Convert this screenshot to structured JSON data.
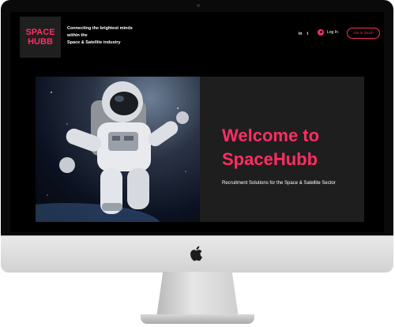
{
  "header": {
    "logo_line1": "SPACE",
    "logo_line2": "HUBB",
    "tagline_line1": "Connecting the brightest minds within the",
    "tagline_line2": "Space & Satellite industry",
    "social": [
      "in",
      "t"
    ],
    "login_label": "Log In",
    "cta_label": "Get in Touch"
  },
  "hero": {
    "title_line1": "Welcome to",
    "title_line2": "SpaceHubb",
    "subtitle": "Recruitment Solutions for the Space & Satellite Sector"
  },
  "colors": {
    "accent": "#ff2e63",
    "background": "#000000",
    "panel": "#1e1e1e"
  }
}
